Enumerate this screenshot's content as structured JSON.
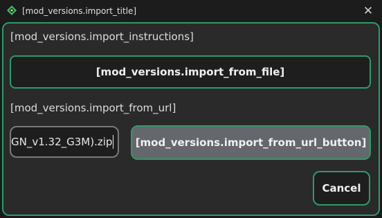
{
  "window": {
    "title": "[mod_versions.import_title]",
    "close_glyph": "✕",
    "icon": "app-diamond-icon",
    "accent_color": "#2e9a6a"
  },
  "dialog": {
    "instructions": "[mod_versions.import_instructions]",
    "import_from_file_label": "[mod_versions.import_from_file]",
    "import_from_url_heading": "[mod_versions.import_from_url]",
    "url_input_value": "GN_v1.32_G3M).zip",
    "import_from_url_button_label": "[mod_versions.import_from_url_button]",
    "cancel_label": "Cancel"
  }
}
